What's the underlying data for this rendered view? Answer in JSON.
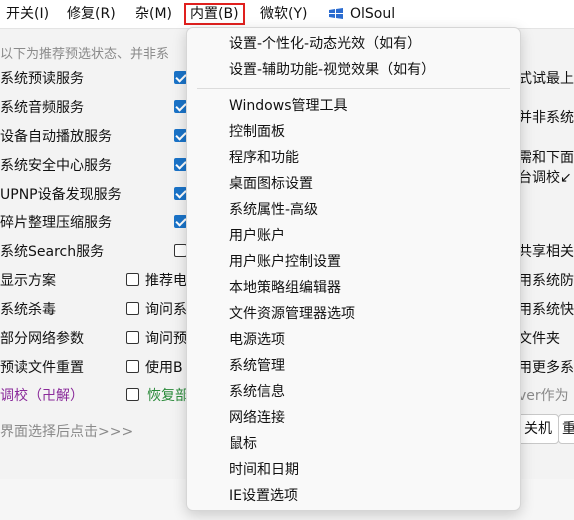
{
  "menubar": {
    "items": [
      {
        "label": "开关(I)"
      },
      {
        "label": "修复(R)"
      },
      {
        "label": "杂(M)"
      },
      {
        "label": "内置(B)"
      },
      {
        "label": "微软(Y)"
      }
    ],
    "brand": "OlSoul",
    "active_color": "#e0201e"
  },
  "background": {
    "hint": "以下为推荐预选状态、并非系",
    "rows": [
      {
        "label": "系统预读服务"
      },
      {
        "label": "系统音频服务"
      },
      {
        "label": "设备自动播放服务"
      },
      {
        "label": "系统安全中心服务"
      },
      {
        "label": "UPNP设备发现服务"
      },
      {
        "label": "碎片整理压缩服务"
      },
      {
        "label": "系统Search服务"
      },
      {
        "label": "显示方案",
        "option": "推荐电"
      },
      {
        "label": "系统杀毒",
        "option": "询问系"
      },
      {
        "label": "部分网络参数",
        "option": "询问预"
      },
      {
        "label": "预读文件重置",
        "option": "使用B"
      },
      {
        "label": "调校（卍解）",
        "option": "恢复部"
      }
    ],
    "footer_hint": "界面选择后点击>>>",
    "right_texts": [
      "式试最上",
      "并非系统",
      "需和下面",
      "台调校↙",
      "共享相关",
      "用系统防火",
      "用系统快速",
      "文件夹",
      "用更多系统",
      "ver作为"
    ],
    "buttons": {
      "shutdown": "关机",
      "more": "重"
    }
  },
  "menu": {
    "items_top": [
      "设置-个性化-动态光效（如有）",
      "设置-辅助功能-视觉效果（如有）"
    ],
    "items": [
      "Windows管理工具",
      "控制面板",
      "程序和功能",
      "桌面图标设置",
      "系统属性-高级",
      "用户账户",
      "用户账户控制设置",
      "本地策略组编辑器",
      "文件资源管理器选项",
      "电源选项",
      "系统管理",
      "系统信息",
      "网络连接",
      "鼠标",
      "时间和日期",
      "IE设置选项"
    ]
  },
  "colors": {
    "checkbox": "#1a73c8",
    "link_purple": "#8a2a9a",
    "link_green": "#2a8a3a"
  }
}
